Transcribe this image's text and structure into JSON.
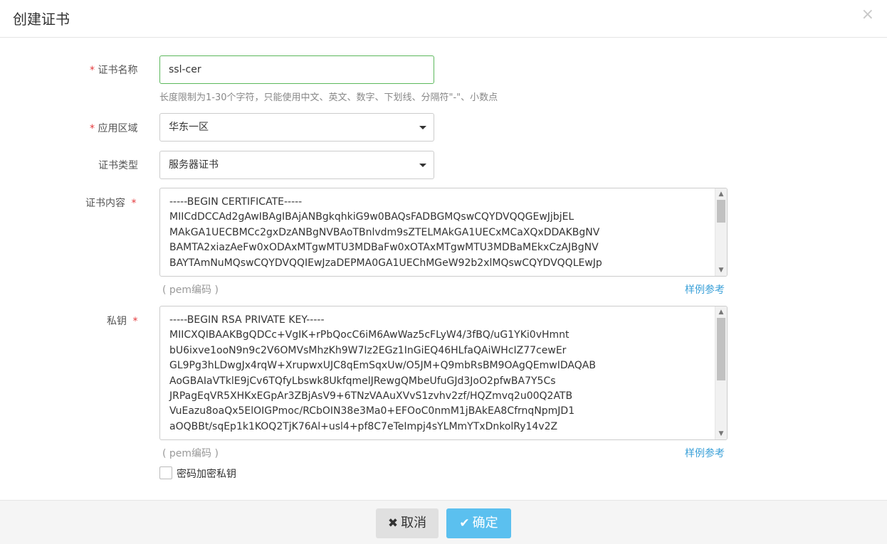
{
  "dialog": {
    "title": "创建证书",
    "close_icon": "×"
  },
  "form": {
    "name": {
      "label": "证书名称",
      "required_mark": "*",
      "value": "ssl-cer",
      "help": "长度限制为1-30个字符，只能使用中文、英文、数字、下划线、分隔符\"-\"、小数点"
    },
    "region": {
      "label": "应用区域",
      "required_mark": "*",
      "value": "华东一区"
    },
    "type": {
      "label": "证书类型",
      "value": "服务器证书"
    },
    "content": {
      "label": "证书内容",
      "required_mark": "*",
      "lines": [
        "-----BEGIN CERTIFICATE-----",
        "MIICdDCCAd2gAwIBAgIBAjANBgkqhkiG9w0BAQsFADBGMQswCQYDVQQGEwJjbjEL",
        "MAkGA1UECBMCc2gxDzANBgNVBAoTBnlvdm9sZTELMAkGA1UECxMCaXQxDDAKBgNV",
        "BAMTA2xiazAeFw0xODAxMTgwMTU3MDBaFw0xOTAxMTgwMTU3MDBaMEkxCzAJBgNV",
        "BAYTAmNuMQswCQYDVQQIEwJzaDEPMA0GA1UEChMGeW92b2xlMQswCQYDVQQLEwJp"
      ],
      "note": "( pem编码 )",
      "example_link": "样例参考",
      "scroll_fraction": 0.35
    },
    "private_key": {
      "label": "私钥",
      "required_mark": "*",
      "lines": [
        "-----BEGIN RSA PRIVATE KEY-----",
        "MIICXQIBAAKBgQDCc+VgIK+rPbQocC6iM6AwWaz5cFLyW4/3fBQ/uG1YKi0vHmnt",
        "bU6ixve1ooN9n9c2V6OMVsMhzKh9W7Iz2EGz1InGiEQ46HLfaQAiWHcIZ77cewEr",
        "GL9Pg3hLDwgJx4rqW+XrupwxUJC8qEmSqxUw/O5JM+Q9mbRsBM9OAgQEmwIDAQAB",
        "AoGBAIaVTklE9jCv6TQfyLbswk8UkfqmelJRewgQMbeUfuGJd3JoO2pfwBA7Y5Cs",
        "JRPagEqVR5XHKxEGpAr3ZBjAsV9+6TNzVAAuXVvS1zvhv2zf/HQZmvq2u00Q2ATB",
        "VuEazu8oaQx5ElOIGPmoc/RCbOIN38e3Ma0+EFOoC0nmM1jBAkEA8CfrnqNpmJD1",
        "aOQBBt/sqEp1k1KOQ2TjK76Al+usl4+pf8C7eTeImpj4sYLMmYTxDnkolRy14v2Z"
      ],
      "note": "( pem编码 )",
      "example_link": "样例参考",
      "scroll_fraction": 0.55
    },
    "encrypt_checkbox": {
      "label": "密码加密私钥",
      "checked": false
    }
  },
  "footer": {
    "cancel": {
      "label": "取消",
      "icon": "close-icon"
    },
    "confirm": {
      "label": "确定",
      "icon": "check-icon"
    },
    "confirm_color": "#5bc0ef"
  }
}
